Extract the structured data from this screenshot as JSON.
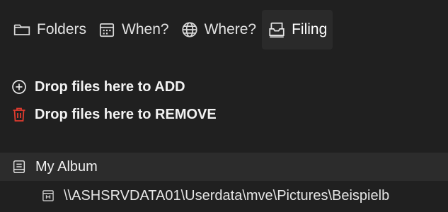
{
  "tabs": [
    {
      "label": "Folders",
      "icon": "folder-icon"
    },
    {
      "label": "When?",
      "icon": "calendar-icon"
    },
    {
      "label": "Where?",
      "icon": "globe-icon"
    },
    {
      "label": "Filing",
      "icon": "inbox-tray-icon",
      "active": true
    }
  ],
  "drop_zone": {
    "add_label": "Drop files here to ADD",
    "add_icon": "plus-circle-icon",
    "remove_label": "Drop files here to REMOVE",
    "remove_icon": "trash-icon",
    "remove_color": "#e03b2f"
  },
  "album": {
    "name": "My Album",
    "icon": "album-icon",
    "path": "\\\\ASHSRVDATA01\\Userdata\\mve\\Pictures\\Beispielb",
    "path_icon": "drive-icon"
  },
  "colors": {
    "background": "#202020",
    "active_tab": "#2a2a2a",
    "selected_row": "#2c2c2c"
  }
}
